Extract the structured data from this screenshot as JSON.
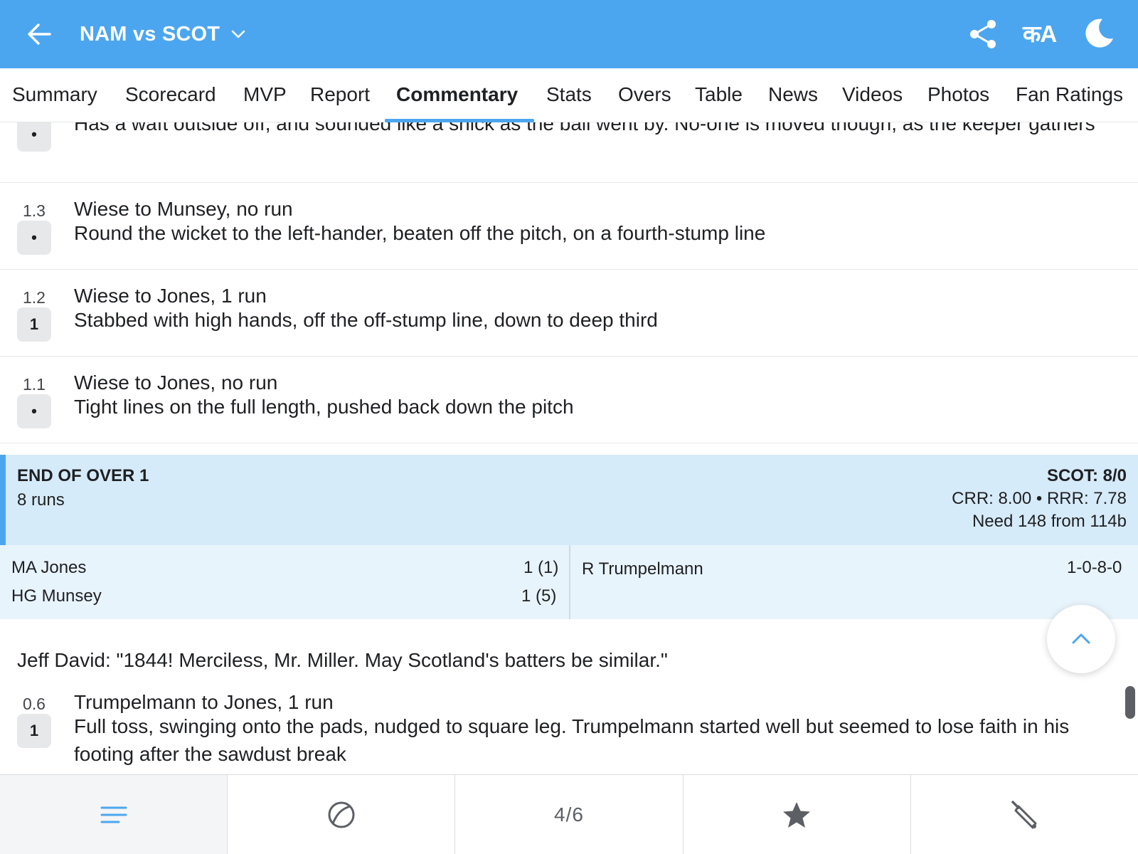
{
  "header": {
    "title": "NAM vs SCOT",
    "lang_label": "कA"
  },
  "tabs": [
    {
      "label": "Summary"
    },
    {
      "label": "Scorecard"
    },
    {
      "label": "MVP"
    },
    {
      "label": "Report"
    },
    {
      "label": "Commentary",
      "active": true
    },
    {
      "label": "Stats"
    },
    {
      "label": "Overs"
    },
    {
      "label": "Table"
    },
    {
      "label": "News"
    },
    {
      "label": "Videos"
    },
    {
      "label": "Photos"
    },
    {
      "label": "Fan Ratings"
    }
  ],
  "commentary": {
    "partial": {
      "badge": "•",
      "desc": "Has a waft outside off, and sounded like a snick as the ball went by. No-one is moved though, as the keeper gathers"
    },
    "balls": [
      {
        "over": "1.3",
        "badge": "•",
        "head": "Wiese to Munsey, no run",
        "desc": "Round the wicket to the left-hander, beaten off the pitch, on a fourth-stump line"
      },
      {
        "over": "1.2",
        "badge": "1",
        "head": "Wiese to Jones, 1 run",
        "desc": "Stabbed with high hands, off the off-stump line, down to deep third"
      },
      {
        "over": "1.1",
        "badge": "•",
        "head": "Wiese to Jones, no run",
        "desc": "Tight lines on the full length, pushed back down the pitch"
      }
    ],
    "end_of_over": {
      "title": "END OF OVER 1",
      "runs": "8 runs",
      "score": "SCOT: 8/0",
      "rates": "CRR: 8.00 • RRR: 7.78",
      "need": "Need 148 from 114b"
    },
    "batters": [
      {
        "name": "MA Jones",
        "score": "1 (1)"
      },
      {
        "name": "HG Munsey",
        "score": "1 (5)"
      }
    ],
    "bowler": {
      "name": "R Trumpelmann",
      "figures": "1-0-8-0"
    },
    "comment": "Jeff David: \"1844! Merciless, Mr. Miller. May Scotland's batters be similar.\"",
    "last_ball": {
      "over": "0.6",
      "badge": "1",
      "head": "Trumpelmann to Jones, 1 run",
      "desc": "Full toss, swinging onto the pads, nudged to square leg. Trumpelmann started well but seemed to lose faith in his footing after the sawdust break"
    }
  },
  "bottom_nav": {
    "items": [
      {
        "icon": "menu-icon",
        "active": true
      },
      {
        "icon": "ball-icon"
      },
      {
        "label": "4/6"
      },
      {
        "icon": "star-icon"
      },
      {
        "icon": "bat-icon"
      }
    ]
  },
  "colors": {
    "accent": "#4ca6ef",
    "end_of_over_bg": "#d6ebf9",
    "batbowl_bg": "#e8f4fc"
  }
}
